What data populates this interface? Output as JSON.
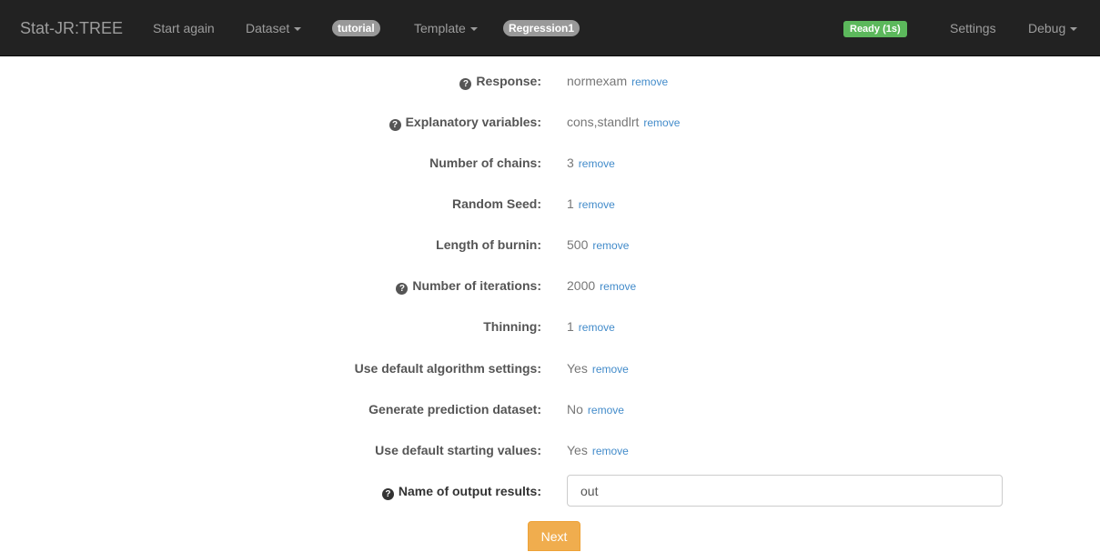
{
  "navbar": {
    "brand": "Stat-JR:TREE",
    "start_again": "Start again",
    "dataset": "Dataset",
    "dataset_badge": "tutorial",
    "template": "Template",
    "template_badge": "Regression1",
    "status": "Ready (1s)",
    "settings": "Settings",
    "debug": "Debug"
  },
  "form": {
    "remove_label": "remove",
    "fields": [
      {
        "label": "Response:",
        "value": "normexam"
      },
      {
        "label": "Explanatory variables:",
        "value": "cons,standlrt"
      },
      {
        "label": "Number of chains:",
        "value": "3"
      },
      {
        "label": "Random Seed:",
        "value": "1"
      },
      {
        "label": "Length of burnin:",
        "value": "500"
      },
      {
        "label": "Number of iterations:",
        "value": "2000"
      },
      {
        "label": "Thinning:",
        "value": "1"
      },
      {
        "label": "Use default algorithm settings:",
        "value": "Yes"
      },
      {
        "label": "Generate prediction dataset:",
        "value": "No"
      },
      {
        "label": "Use default starting values:",
        "value": "Yes"
      }
    ],
    "output": {
      "label": "Name of output results:",
      "value": "out"
    },
    "next_label": "Next"
  },
  "colors": {
    "navbar": "#222222",
    "ready": "#5cb85c",
    "link": "#428bca",
    "next": "#f0ad4e"
  }
}
